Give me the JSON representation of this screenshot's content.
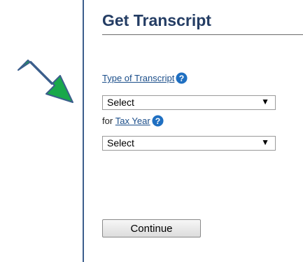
{
  "form": {
    "title": "Get Transcript",
    "type_label": "Type of Transcript",
    "type_select_value": "Select",
    "tax_prefix": "for ",
    "tax_label": "Tax Year",
    "tax_select_value": "Select",
    "continue_label": "Continue"
  },
  "icons": {
    "help": "question-circle-icon",
    "dropdown": "dropdown-arrow-icon",
    "pointer": "green-arrow-icon"
  },
  "colors": {
    "title": "#243d64",
    "link": "#1b4e8a",
    "help_icon": "#1f6fc1",
    "arrow_fill": "#16a34a",
    "arrow_stroke": "#3b5e8c"
  }
}
